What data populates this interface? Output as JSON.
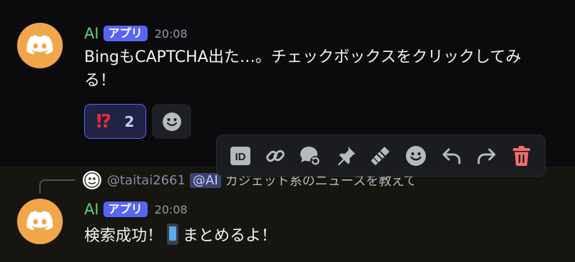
{
  "message1": {
    "author": "AI",
    "badge": "アプリ",
    "time": "20:08",
    "text": "BingもCAPTCHA出た…。チェックボックスをクリックしてみる！",
    "reactions": [
      {
        "emoji": "⁉",
        "count": "2"
      }
    ]
  },
  "toolbar": {
    "actions": [
      "copy-id",
      "copy-link",
      "create-thread",
      "pin",
      "apps",
      "add-reaction",
      "reply",
      "forward",
      "delete"
    ]
  },
  "message2": {
    "reply": {
      "user": "@taitai2661",
      "mention": "@AI",
      "text": "カジェット系のニュースを教えて"
    },
    "author": "AI",
    "badge": "アプリ",
    "time": "20:08",
    "text_before": "検索成功！",
    "text_after": "まとめるよ！"
  },
  "colors": {
    "author": "#5fd379",
    "badge": "#5865f2",
    "avatar": "#f0a64a",
    "delete": "#f26d6d"
  }
}
